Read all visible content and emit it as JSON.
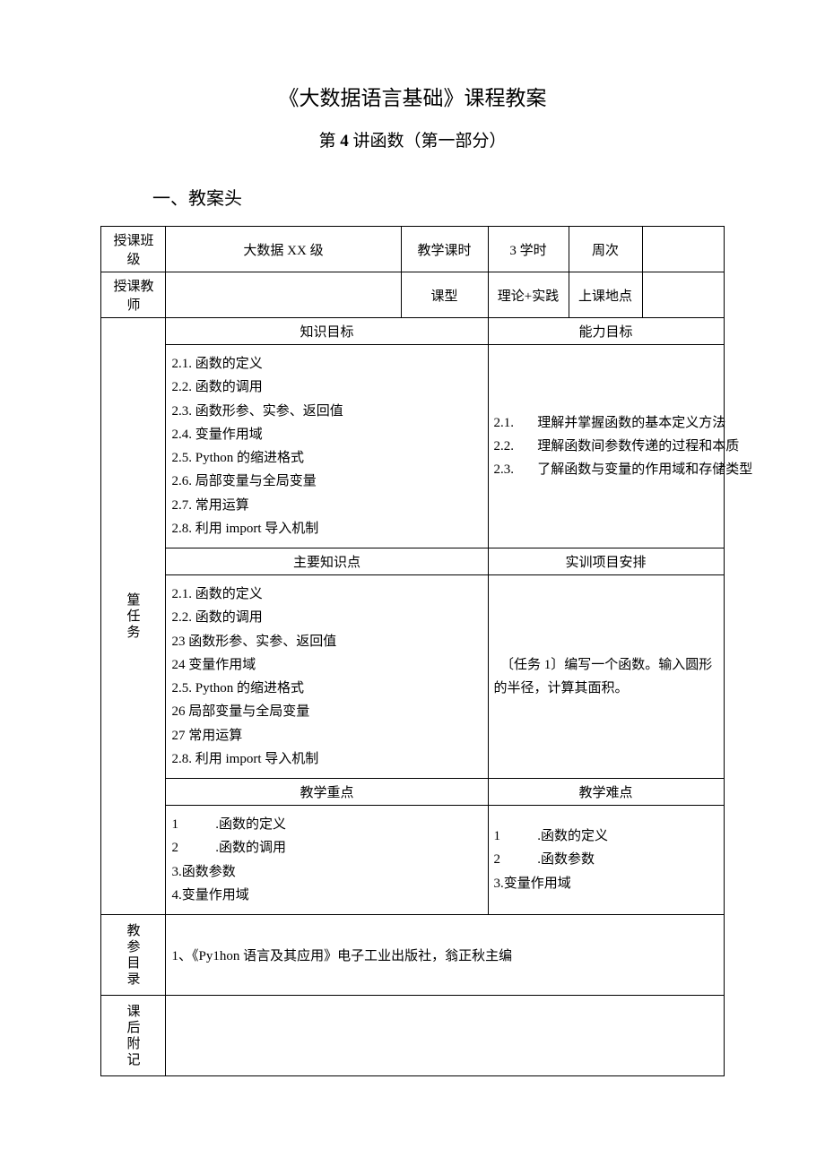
{
  "title": "《大数据语言基础》课程教案",
  "subtitle": "第 4 讲函数（第一部分）",
  "section1": "一、教案头",
  "labels": {
    "class_label": "授课班级",
    "class_value": "大数据 XX 级",
    "hours_label": "教学课时",
    "hours_value": "3 学时",
    "week_label": "周次",
    "week_value": "",
    "teacher_label": "授课教师",
    "teacher_value": "",
    "type_label": "课型",
    "type_value": "理论+实践",
    "location_label": "上课地点",
    "location_value": "",
    "task_header": "篂任务",
    "knowledge_goal": "知识目标",
    "ability_goal": "能力目标",
    "key_points": "主要知识点",
    "practice": "实训项目安排",
    "teach_focus": "教学重点",
    "teach_difficulty": "教学难点",
    "ref_catalog": "教参目录",
    "postscript": "课后附记"
  },
  "knowledge_goals": [
    "2.1. 函数的定义",
    "2.2. 函数的调用",
    "2.3. 函数形参、实参、返回值",
    "2.4. 变量作用域",
    "2.5. Python 的缩进格式",
    "2.6. 局部变量与全局变量",
    "2.7. 常用运算",
    "2.8. 利用 import 导入机制"
  ],
  "ability_goals": [
    "2.1.       理解并掌握函数的基本定义方法",
    "2.2.       理解函数间参数传递的过程和本质",
    "2.3.       了解函数与变量的作用域和存储类型"
  ],
  "key_points_list": [
    "2.1. 函数的定义",
    "2.2. 函数的调用",
    "23 函数形参、实参、返回值",
    "24 变量作用域",
    "2.5. Python 的缩进格式",
    "26 局部变量与全局变量",
    "27 常用运算",
    "2.8. 利用 import 导入机制"
  ],
  "practice_text": "　〔任务 1〕编写一个函数。输入圆形的半径，计算其面积。",
  "focus_list": [
    "1           .函数的定义",
    "2           .函数的调用",
    "3.函数参数",
    "4.变量作用域"
  ],
  "difficulty_list": [
    "1           .函数的定义",
    "2           .函数参数",
    "3.变量作用域"
  ],
  "reference": "1、《Py1hon 语言及其应用》电子工业出版社，翁正秋主编",
  "postscript_text": ""
}
